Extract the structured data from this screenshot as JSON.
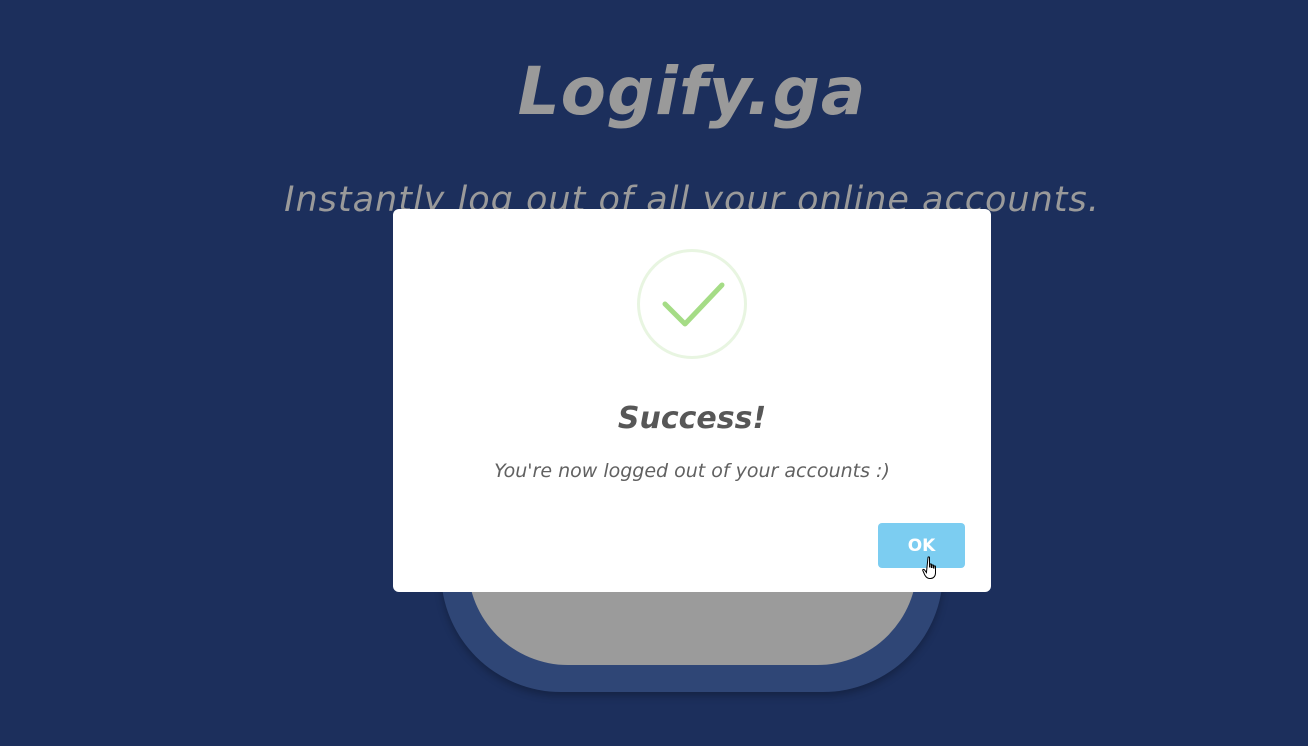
{
  "site": {
    "title": "Logify.ga",
    "tagline": "Instantly log out of all your online accounts."
  },
  "modal": {
    "icon": "checkmark-icon",
    "title": "Success!",
    "text": "You're now logged out of your accounts :)",
    "ok_label": "OK"
  },
  "colors": {
    "background": "#1c2f5c",
    "heading_text": "#9a9a9a",
    "check_green": "#a5dc86",
    "ok_button": "#7ccdf1"
  }
}
